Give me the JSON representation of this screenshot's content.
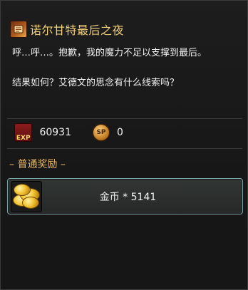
{
  "quest": {
    "title": "诺尔甘特最后之夜",
    "title_icon": "quest-scroll-icon"
  },
  "dialog": {
    "line1": "呼…呼…。抱歉，我的魔力不足以支撑到最后。",
    "line2": "结果如何？艾德文的思念有什么线索吗？"
  },
  "rewards": {
    "exp_icon_text": "EXP",
    "exp_value": "60931",
    "sp_icon_text": "SP",
    "sp_value": "0"
  },
  "normal_reward": {
    "section_label": "普通奖励",
    "dash_left": "–",
    "dash_right": "–",
    "item_label": "金币 * 5141",
    "item_icon": "gold-coins-icon"
  },
  "colors": {
    "title": "#f0cf7b",
    "section": "#e6b765",
    "item_border": "#7da4a6"
  }
}
